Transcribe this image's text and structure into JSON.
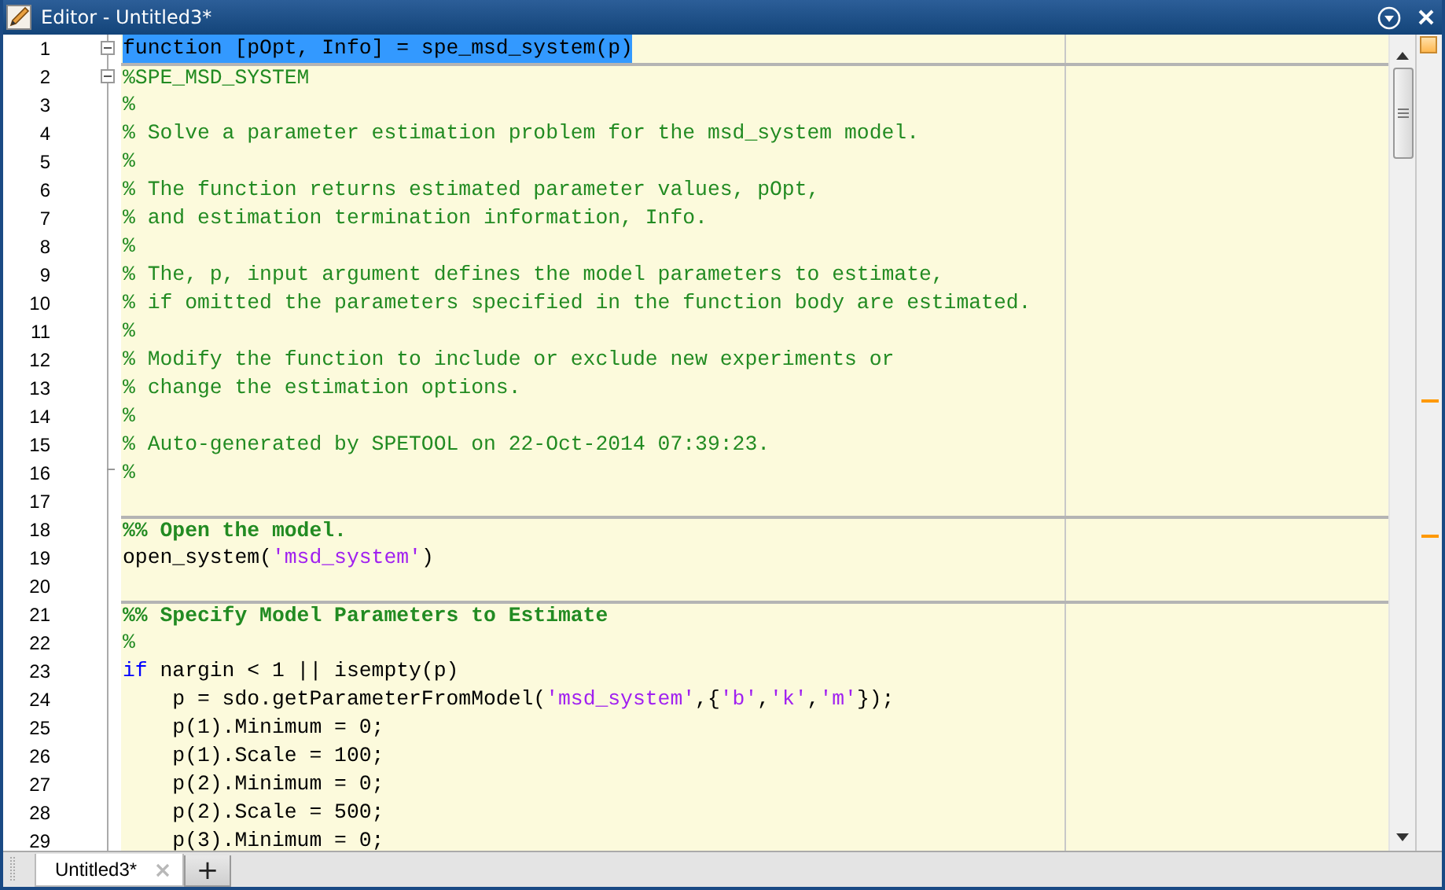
{
  "window": {
    "title": "Editor - Untitled3*"
  },
  "lines": [
    {
      "number": "1",
      "selected": true,
      "cell_break": false,
      "expanded": true,
      "tokens": [
        {
          "kind": "plain",
          "text": "function [pOpt, Info] = spe_msd_system(p)"
        }
      ]
    },
    {
      "number": "2",
      "selected": false,
      "cell_break": true,
      "expanded": true,
      "tokens": [
        {
          "kind": "comment",
          "text": "%SPE_MSD_SYSTEM"
        }
      ]
    },
    {
      "number": "3",
      "selected": false,
      "cell_break": false,
      "tokens": [
        {
          "kind": "comment",
          "text": "%"
        }
      ]
    },
    {
      "number": "4",
      "selected": false,
      "cell_break": false,
      "tokens": [
        {
          "kind": "comment",
          "text": "% Solve a parameter estimation problem for the msd_system model."
        }
      ]
    },
    {
      "number": "5",
      "selected": false,
      "cell_break": false,
      "tokens": [
        {
          "kind": "comment",
          "text": "%"
        }
      ]
    },
    {
      "number": "6",
      "selected": false,
      "cell_break": false,
      "tokens": [
        {
          "kind": "comment",
          "text": "% The function returns estimated parameter values, pOpt,"
        }
      ]
    },
    {
      "number": "7",
      "selected": false,
      "cell_break": false,
      "tokens": [
        {
          "kind": "comment",
          "text": "% and estimation termination information, Info."
        }
      ]
    },
    {
      "number": "8",
      "selected": false,
      "cell_break": false,
      "tokens": [
        {
          "kind": "comment",
          "text": "%"
        }
      ]
    },
    {
      "number": "9",
      "selected": false,
      "cell_break": false,
      "tokens": [
        {
          "kind": "comment",
          "text": "% The, p, input argument defines the model parameters to estimate,"
        }
      ]
    },
    {
      "number": "10",
      "selected": false,
      "cell_break": false,
      "tokens": [
        {
          "kind": "comment",
          "text": "% if omitted the parameters specified in the function body are estimated."
        }
      ]
    },
    {
      "number": "11",
      "selected": false,
      "cell_break": false,
      "tokens": [
        {
          "kind": "comment",
          "text": "%"
        }
      ]
    },
    {
      "number": "12",
      "selected": false,
      "cell_break": false,
      "tokens": [
        {
          "kind": "comment",
          "text": "% Modify the function to include or exclude new experiments or"
        }
      ]
    },
    {
      "number": "13",
      "selected": false,
      "cell_break": false,
      "tokens": [
        {
          "kind": "comment",
          "text": "% change the estimation options."
        }
      ]
    },
    {
      "number": "14",
      "selected": false,
      "cell_break": false,
      "tokens": [
        {
          "kind": "comment",
          "text": "%"
        }
      ]
    },
    {
      "number": "15",
      "selected": false,
      "cell_break": false,
      "tokens": [
        {
          "kind": "comment",
          "text": "% Auto-generated by SPETOOL on 22-Oct-2014 07:39:23."
        }
      ]
    },
    {
      "number": "16",
      "selected": false,
      "cell_break": false,
      "fold_end": true,
      "tokens": [
        {
          "kind": "comment",
          "text": "%"
        }
      ]
    },
    {
      "number": "17",
      "selected": false,
      "cell_break": false
    },
    {
      "number": "18",
      "selected": false,
      "cell_break": true,
      "tokens": [
        {
          "kind": "cell_title",
          "text": "%% Open the model."
        }
      ]
    },
    {
      "number": "19",
      "selected": false,
      "cell_break": false,
      "tokens": [
        {
          "kind": "plain",
          "text": "open_system("
        },
        {
          "kind": "string",
          "text": "'msd_system'"
        },
        {
          "kind": "plain",
          "text": ")"
        }
      ]
    },
    {
      "number": "20",
      "selected": false,
      "cell_break": false
    },
    {
      "number": "21",
      "selected": false,
      "cell_break": true,
      "tokens": [
        {
          "kind": "cell_title",
          "text": "%% Specify Model Parameters to Estimate"
        }
      ]
    },
    {
      "number": "22",
      "selected": false,
      "cell_break": false,
      "tokens": [
        {
          "kind": "comment",
          "text": "%"
        }
      ]
    },
    {
      "number": "23",
      "selected": false,
      "cell_break": false,
      "tokens": [
        {
          "kind": "keyword",
          "text": "if"
        },
        {
          "kind": "plain",
          "text": " nargin < 1 || isempty(p)"
        }
      ]
    },
    {
      "number": "24",
      "selected": false,
      "cell_break": false,
      "tokens": [
        {
          "kind": "plain",
          "text": "    p = sdo.getParameterFromModel("
        },
        {
          "kind": "string",
          "text": "'msd_system'"
        },
        {
          "kind": "plain",
          "text": ",{"
        },
        {
          "kind": "string",
          "text": "'b'"
        },
        {
          "kind": "plain",
          "text": ","
        },
        {
          "kind": "string",
          "text": "'k'"
        },
        {
          "kind": "plain",
          "text": ","
        },
        {
          "kind": "string",
          "text": "'m'"
        },
        {
          "kind": "plain",
          "text": "});"
        }
      ]
    },
    {
      "number": "25",
      "selected": false,
      "cell_break": false,
      "tokens": [
        {
          "kind": "plain",
          "text": "    p(1).Minimum = 0;"
        }
      ]
    },
    {
      "number": "26",
      "selected": false,
      "cell_break": false,
      "tokens": [
        {
          "kind": "plain",
          "text": "    p(1).Scale = 100;"
        }
      ]
    },
    {
      "number": "27",
      "selected": false,
      "cell_break": false,
      "tokens": [
        {
          "kind": "plain",
          "text": "    p(2).Minimum = 0;"
        }
      ]
    },
    {
      "number": "28",
      "selected": false,
      "cell_break": false,
      "tokens": [
        {
          "kind": "plain",
          "text": "    p(2).Scale = 500;"
        }
      ]
    },
    {
      "number": "29",
      "selected": false,
      "cell_break": false,
      "tokens": [
        {
          "kind": "plain",
          "text": "    p(3).Minimum = 0;"
        }
      ]
    }
  ],
  "tabs": [
    {
      "label": "Untitled3*",
      "selected": true
    }
  ],
  "new_tab_button": "+"
}
